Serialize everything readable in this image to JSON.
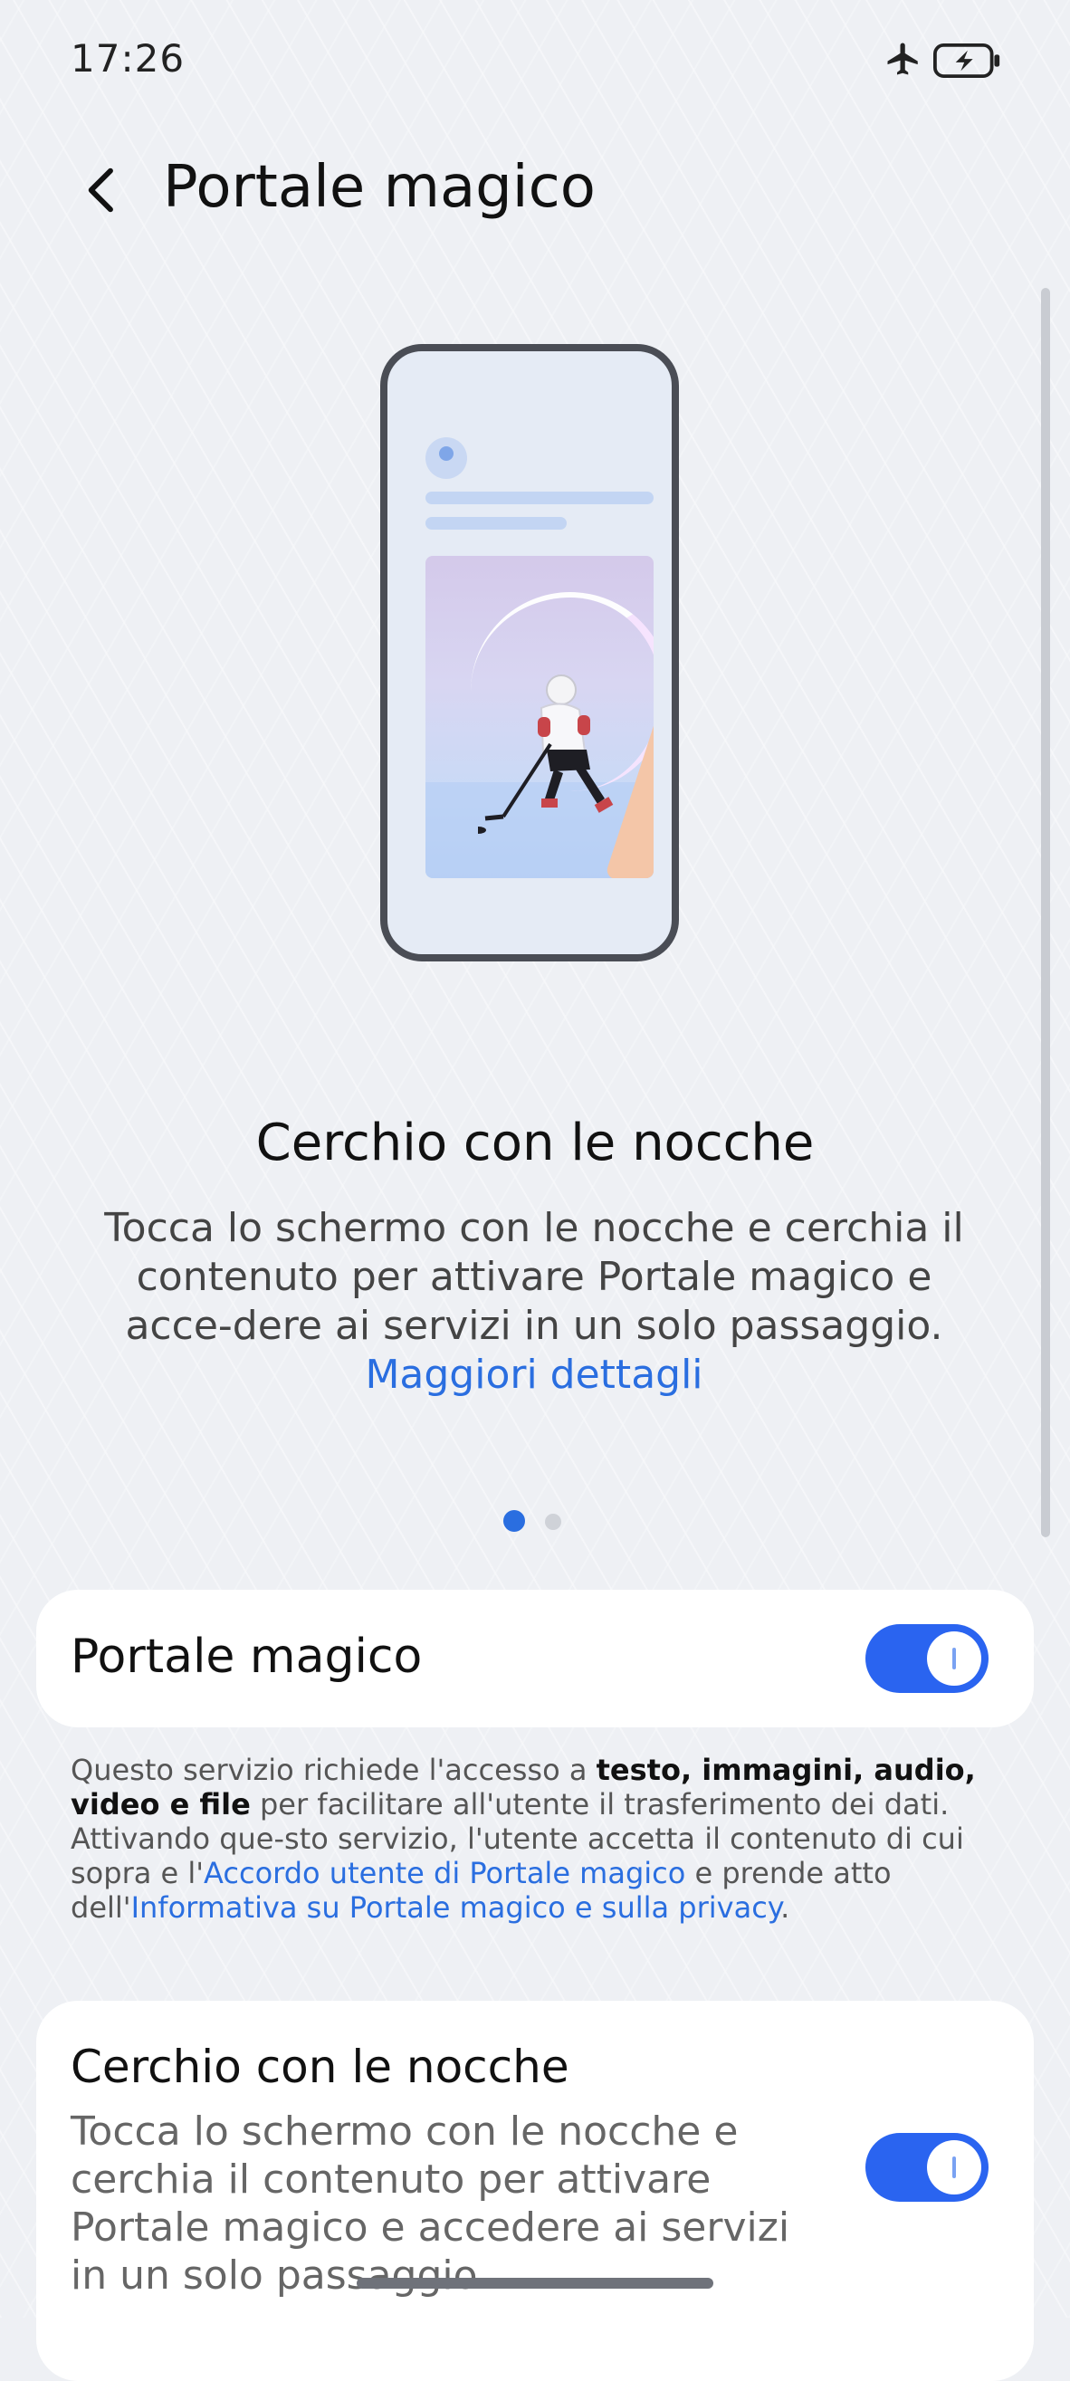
{
  "status_bar": {
    "time": "17:26",
    "icons": [
      "airplane-icon",
      "battery-charging-icon"
    ]
  },
  "header": {
    "back_icon": "chevron-left-icon",
    "title": "Portale magico"
  },
  "feature": {
    "title": "Cerchio con le nocche",
    "description": "Tocca lo schermo con le nocche e cerchia il contenuto per attivare Portale magico e acce-dere ai servizi in un solo passaggio.",
    "more_link": "Maggiori dettagli"
  },
  "pager": {
    "count": 2,
    "active_index": 0
  },
  "magic_portal_setting": {
    "label": "Portale magico",
    "enabled": true
  },
  "notice": {
    "part1": "Questo servizio richiede l'accesso a ",
    "bold": "testo, immagini, audio, video e file",
    "part2": " per facilitare all'utente il trasferimento dei dati. Attivando que-sto servizio, l'utente accetta il contenuto di cui sopra e l'",
    "link1": "Accordo utente di Portale magico",
    "part3": " e prende atto dell'",
    "link2": "Informativa su Portale magico e sulla privacy",
    "part4": "."
  },
  "knuckle_setting": {
    "title": "Cerchio con le nocche",
    "description": "Tocca lo schermo con le nocche e cerchia il contenuto per attivare Portale magico e accedere ai servizi in un solo passaggio.",
    "enabled": true
  },
  "colors": {
    "accent": "#2a64f0",
    "link": "#2a6ee0",
    "background": "#eef0f4"
  }
}
